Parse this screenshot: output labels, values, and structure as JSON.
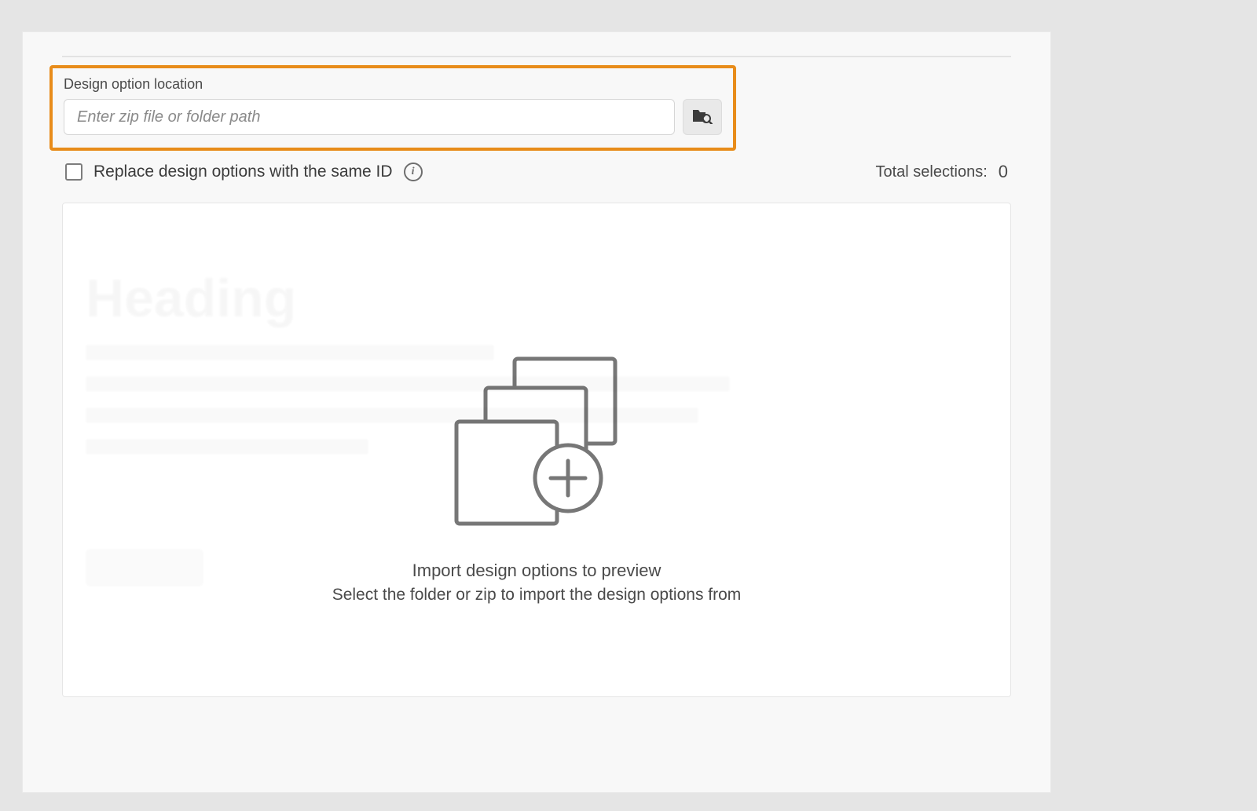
{
  "location": {
    "label": "Design option location",
    "placeholder": "Enter zip file or folder path",
    "value": ""
  },
  "options": {
    "replace_label": "Replace design options with the same ID",
    "replace_checked": false
  },
  "summary": {
    "total_label": "Total selections:",
    "total_value": "0"
  },
  "empty_state": {
    "title": "Import design options to preview",
    "subtitle": "Select the folder or zip to import the design options from"
  }
}
